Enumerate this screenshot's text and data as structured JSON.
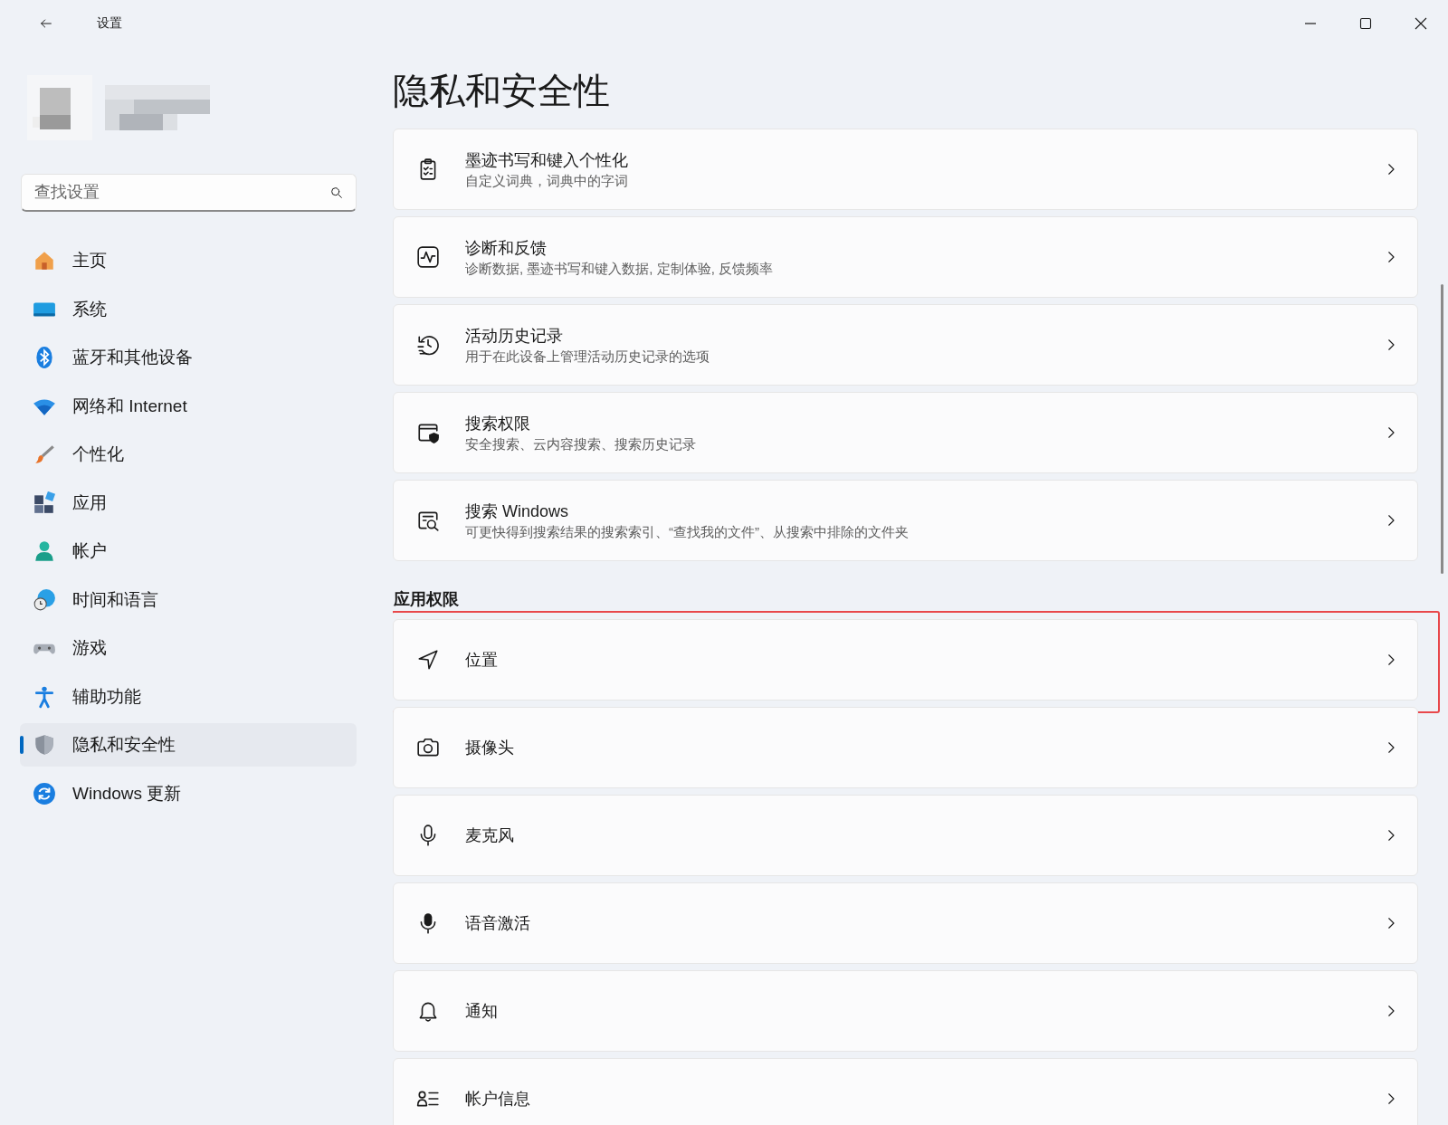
{
  "window": {
    "title": "设置"
  },
  "search": {
    "placeholder": "查找设置"
  },
  "sidebar": {
    "items": [
      {
        "label": "主页",
        "selected": false
      },
      {
        "label": "系统",
        "selected": false
      },
      {
        "label": "蓝牙和其他设备",
        "selected": false
      },
      {
        "label": "网络和 Internet",
        "selected": false
      },
      {
        "label": "个性化",
        "selected": false
      },
      {
        "label": "应用",
        "selected": false
      },
      {
        "label": "帐户",
        "selected": false
      },
      {
        "label": "时间和语言",
        "selected": false
      },
      {
        "label": "游戏",
        "selected": false
      },
      {
        "label": "辅助功能",
        "selected": false
      },
      {
        "label": "隐私和安全性",
        "selected": true
      },
      {
        "label": "Windows 更新",
        "selected": false
      }
    ]
  },
  "page": {
    "title": "隐私和安全性"
  },
  "settings": [
    {
      "title": "墨迹书写和键入个性化",
      "description": "自定义词典，词典中的字词"
    },
    {
      "title": "诊断和反馈",
      "description": "诊断数据, 墨迹书写和键入数据, 定制体验, 反馈频率"
    },
    {
      "title": "活动历史记录",
      "description": "用于在此设备上管理活动历史记录的选项"
    },
    {
      "title": "搜索权限",
      "description": "安全搜索、云内容搜索、搜索历史记录"
    },
    {
      "title": "搜索 Windows",
      "description": "可更快得到搜索结果的搜索索引、“查找我的文件”、从搜索中排除的文件夹"
    }
  ],
  "permissions": {
    "heading": "应用权限",
    "items": [
      {
        "title": "位置",
        "highlighted": true
      },
      {
        "title": "摄像头",
        "highlighted": false
      },
      {
        "title": "麦克风",
        "highlighted": false
      },
      {
        "title": "语音激活",
        "highlighted": false
      },
      {
        "title": "通知",
        "highlighted": false
      },
      {
        "title": "帐户信息",
        "highlighted": false
      }
    ]
  }
}
